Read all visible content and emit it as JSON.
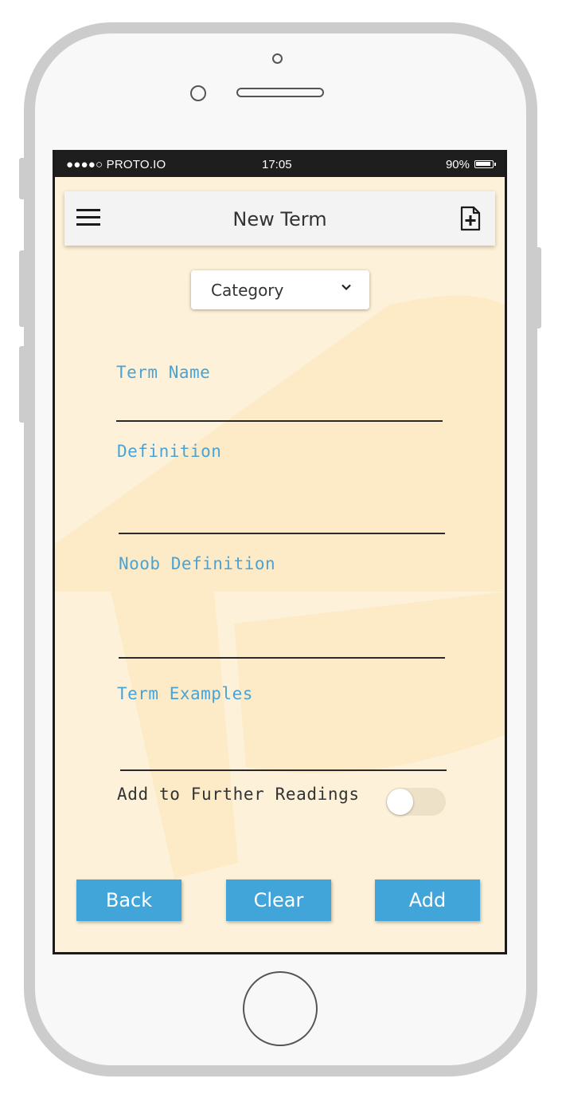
{
  "status_bar": {
    "carrier": "●●●●○ PROTO.IO",
    "time": "17:05",
    "battery": "90%"
  },
  "app_bar": {
    "title": "New Term",
    "menu_icon": "hamburger-menu-icon",
    "action_icon": "add-document-icon"
  },
  "category": {
    "label": "Category"
  },
  "fields": {
    "term_name": {
      "label": "Term Name",
      "value": ""
    },
    "definition": {
      "label": "Definition",
      "value": ""
    },
    "noob_definition": {
      "label": "Noob Definition",
      "value": ""
    },
    "term_examples": {
      "label": "Term Examples",
      "value": ""
    }
  },
  "further_readings": {
    "label": "Add to Further Readings",
    "enabled": false
  },
  "buttons": {
    "back": "Back",
    "clear": "Clear",
    "add": "Add"
  },
  "colors": {
    "accent": "#42a5d9",
    "label": "#4aa3d6",
    "background": "#fdf2d9",
    "watermark": "#fcebc6"
  }
}
